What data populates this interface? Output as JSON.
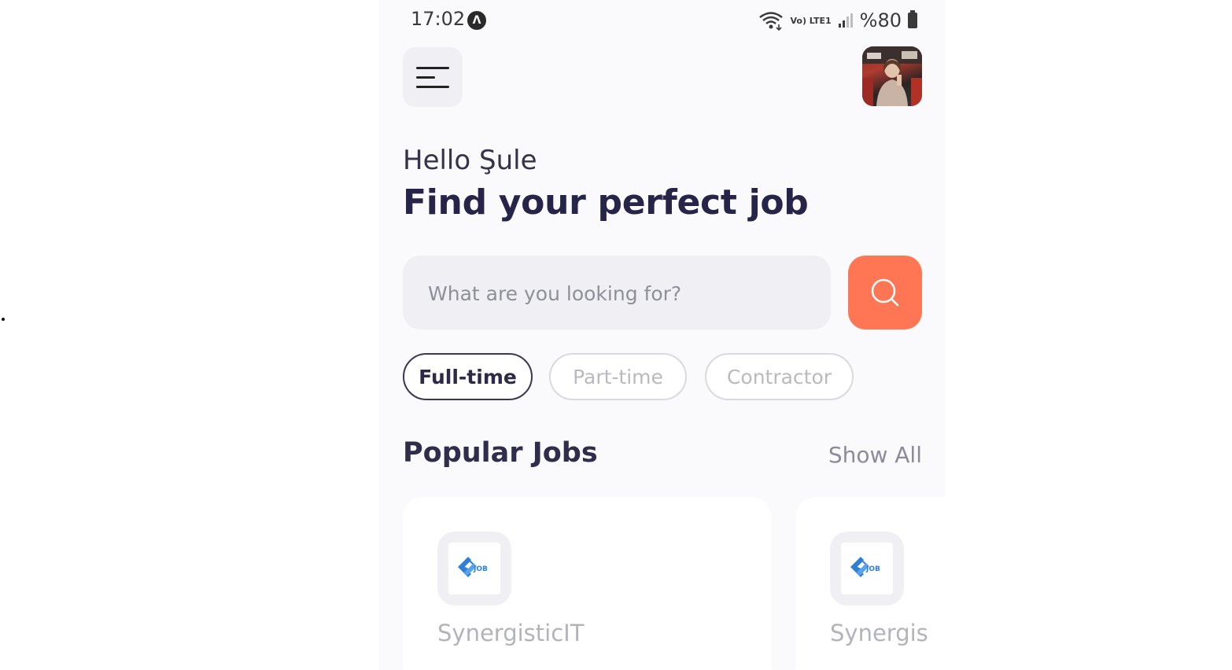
{
  "status_bar": {
    "time": "17:02",
    "app_icon": "Λ",
    "network": "Vo) LTE1",
    "battery": "%80"
  },
  "header": {
    "greeting": "Hello Şule",
    "headline": "Find your perfect job"
  },
  "search": {
    "placeholder": "What are you looking for?"
  },
  "filters": [
    {
      "label": "Full-time",
      "active": true
    },
    {
      "label": "Part-time",
      "active": false
    },
    {
      "label": "Contractor",
      "active": false
    }
  ],
  "popular": {
    "title": "Popular Jobs",
    "show_all": "Show All"
  },
  "jobs": [
    {
      "company": "SynergisticIT",
      "logo_text": "JOB"
    },
    {
      "company": "Synergis",
      "logo_text": "JOB"
    }
  ],
  "colors": {
    "accent": "#ff7654",
    "text_dark": "#27244a",
    "logo_blue": "#2f7fd6"
  }
}
